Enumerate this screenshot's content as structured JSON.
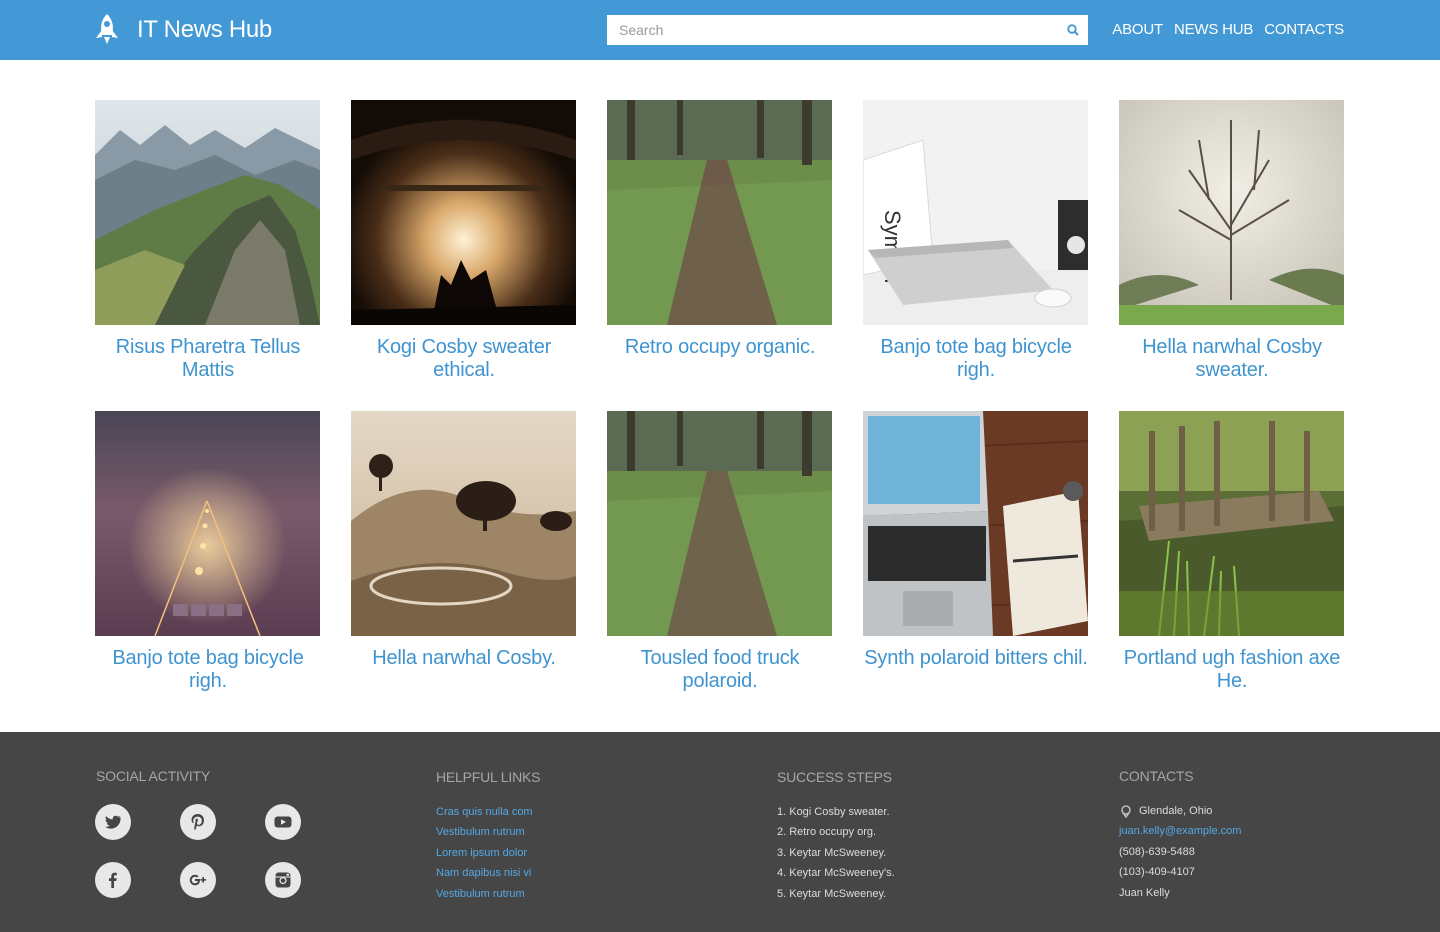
{
  "header": {
    "brand": "IT News Hub",
    "logo_icon": "rocket-icon",
    "search_placeholder": "Search",
    "search_icon": "search-icon",
    "nav": [
      "ABOUT",
      "NEWS HUB",
      "CONTACTS"
    ],
    "background": "#4299d6"
  },
  "grid": {
    "caption_color": "#3f94cf",
    "tiles": [
      {
        "caption": "Risus Pharetra Tellus Mattis",
        "image": "mountain-ridge-photo"
      },
      {
        "caption": "Kogi Cosby sweater ethical.",
        "image": "concert-stage-photo"
      },
      {
        "caption": "Retro occupy organic.",
        "image": "forest-path-photo"
      },
      {
        "caption": "Banjo tote bag bicycle righ.",
        "image": "laptop-desk-photo"
      },
      {
        "caption": "Hella narwhal Cosby sweater.",
        "image": "bare-tree-photo"
      },
      {
        "caption": "Banjo tote bag bicycle righ.",
        "image": "foggy-railway-photo"
      },
      {
        "caption": "Hella narwhal Cosby.",
        "image": "sepia-hills-photo"
      },
      {
        "caption": "Tousled food truck polaroid.",
        "image": "forest-path-photo"
      },
      {
        "caption": "Synth polaroid bitters chil.",
        "image": "laptop-notebook-photo"
      },
      {
        "caption": "Portland ugh fashion axe He.",
        "image": "wooden-pier-photo"
      }
    ]
  },
  "footer": {
    "background": "#464646",
    "social": {
      "heading": "SOCIAL ACTIVITY",
      "icons": [
        "twitter-icon",
        "pinterest-icon",
        "youtube-icon",
        "facebook-icon",
        "google-plus-icon",
        "instagram-icon"
      ]
    },
    "links": {
      "heading": "HELPFUL LINKS",
      "items": [
        "Cras quis nulla com",
        "Vestibulum rutrum",
        "Lorem ipsum dolor",
        "Nam dapibus nisi vi",
        "Vestibulum rutrum"
      ]
    },
    "steps": {
      "heading": "SUCCESS STEPS",
      "items": [
        "1. Kogi Cosby sweater.",
        "2. Retro occupy org.",
        "3. Keytar McSweeney.",
        "4. Keytar McSweeney's.",
        "5. Keytar McSweeney."
      ]
    },
    "contacts": {
      "heading": "CONTACTS",
      "location_icon": "location-pin-icon",
      "location": "Glendale, Ohio",
      "email": "juan.kelly@example.com",
      "phone1": "(508)-639-5488",
      "phone2": "(103)-409-4107",
      "name": "Juan Kelly"
    }
  }
}
